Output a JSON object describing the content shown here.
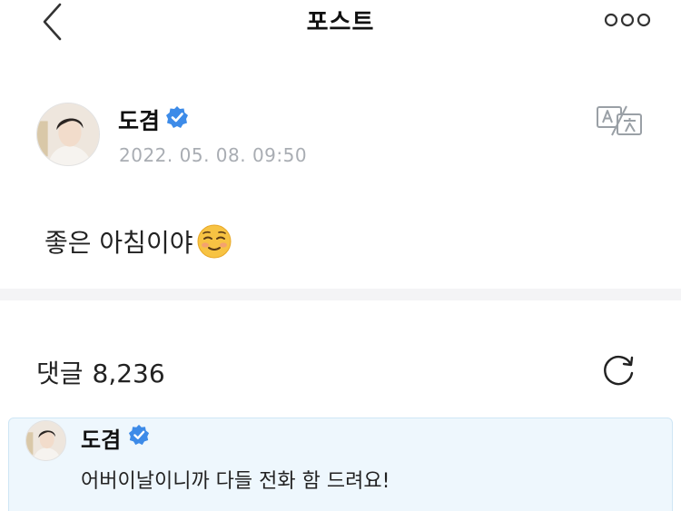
{
  "header": {
    "title": "포스트",
    "back_icon": "chevron-left-icon",
    "more_icon": "more-horizontal-icon"
  },
  "post": {
    "author": {
      "name": "도겸",
      "verified": true,
      "verified_icon": "verified-badge-icon",
      "avatar_icon": "avatar-photo"
    },
    "date": "2022. 05. 08. 09:50",
    "translate_icon": "translate-icon",
    "body": "좋은 아침이야",
    "body_emoji": "smiling-face-icon"
  },
  "comments": {
    "label": "댓글",
    "count": "8,236",
    "refresh_icon": "refresh-icon",
    "pinned": {
      "author": {
        "name": "도겸",
        "verified": true,
        "avatar_icon": "avatar-photo"
      },
      "text": "어버이날이니까 다들 전화 함 드려요!"
    }
  },
  "colors": {
    "verified_blue": "#3d8be8",
    "date_gray": "#a9adb3",
    "divider": "#f4f4f6",
    "comment_card_bg": "#eef7fd",
    "comment_card_border": "#cfe6f5",
    "emoji_yellow": "#f7c343"
  }
}
